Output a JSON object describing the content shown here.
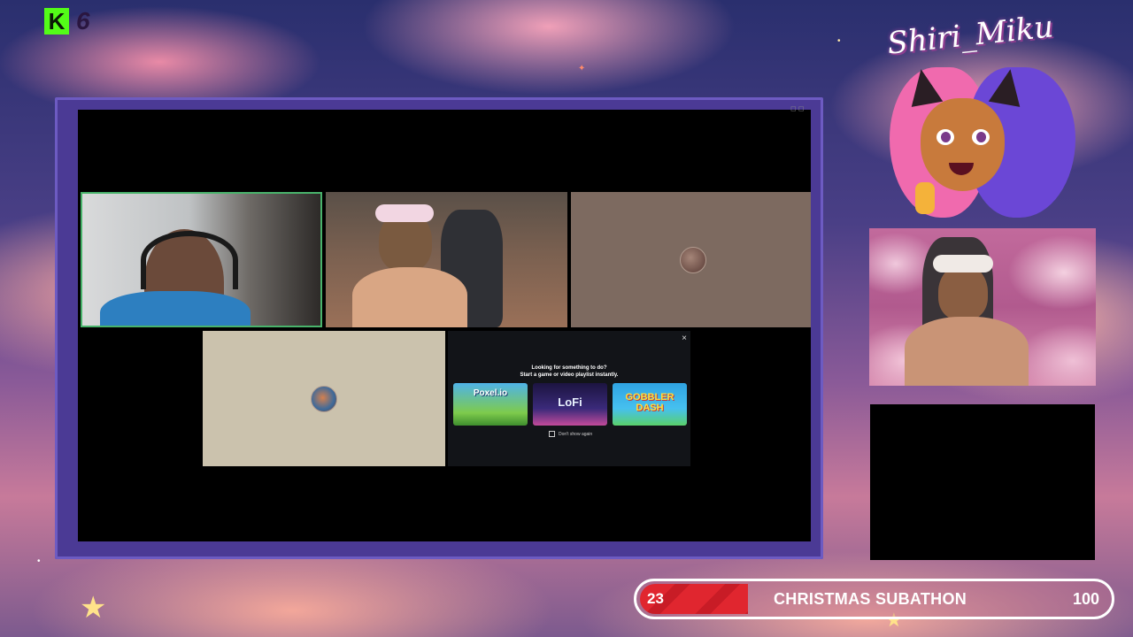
{
  "kick": {
    "logo_letter": "K",
    "viewer_count": "6",
    "brand_color": "#53fc18"
  },
  "streamer": {
    "name": "Shiri_Miku"
  },
  "activity_prompt": {
    "heading_line1": "Looking for something to do?",
    "heading_line2": "Start a game or video playlist instantly.",
    "cards": [
      {
        "label": "Poxel.io"
      },
      {
        "label": "LoFi"
      },
      {
        "label": "GOBBLER DASH"
      }
    ],
    "dont_show_label": "Don't show again",
    "close_label": "×"
  },
  "subathon": {
    "current": 23,
    "title": "CHRISTMAS SUBATHON",
    "target": 100,
    "progress": 0.23,
    "bar_color": "#e0262f"
  }
}
